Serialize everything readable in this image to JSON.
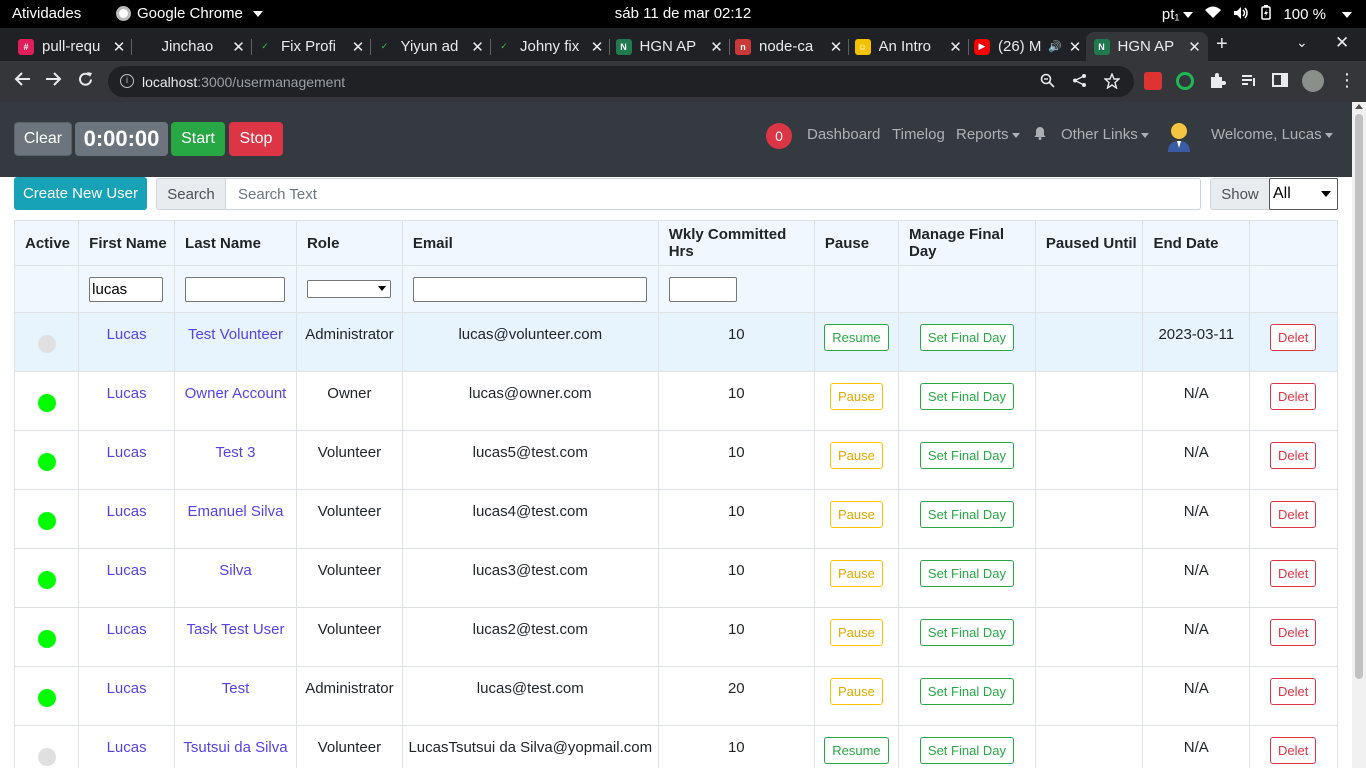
{
  "system": {
    "activities": "Atividades",
    "app_name": "Google Chrome",
    "clock": "sáb 11 de mar  02:12",
    "keyboard": "pt₁",
    "battery": "100 %"
  },
  "tabs": [
    {
      "title": "pull-requ",
      "favicon": "slack",
      "active": false
    },
    {
      "title": "Jinchao",
      "favicon": "github",
      "active": false
    },
    {
      "title": "Fix Profi",
      "favicon": "check",
      "active": false
    },
    {
      "title": "Yiyun ad",
      "favicon": "check",
      "active": false
    },
    {
      "title": "Johny fix",
      "favicon": "check",
      "active": false
    },
    {
      "title": "HGN AP",
      "favicon": "hgn",
      "active": false
    },
    {
      "title": "node-ca",
      "favicon": "npm",
      "active": false
    },
    {
      "title": "An Intro",
      "favicon": "smiley",
      "active": false
    },
    {
      "title": "(26) M",
      "favicon": "youtube",
      "active": false
    },
    {
      "title": "HGN AP",
      "favicon": "hgn",
      "active": true
    }
  ],
  "address_bar": {
    "host": "localhost",
    "path": ":3000/usermanagement"
  },
  "timer": {
    "clear": "Clear",
    "time": "0:00:00",
    "start": "Start",
    "stop": "Stop"
  },
  "nav": {
    "badge": "0",
    "dashboard": "Dashboard",
    "timelog": "Timelog",
    "reports": "Reports",
    "other_links": "Other Links",
    "welcome": "Welcome, Lucas"
  },
  "controls": {
    "create": "Create New User",
    "search_label": "Search",
    "search_placeholder": "Search Text",
    "show_label": "Show",
    "show_value": "All"
  },
  "columns": [
    "Active",
    "First Name",
    "Last Name",
    "Role",
    "Email",
    "Wkly Committed Hrs",
    "Pause",
    "Manage Final Day",
    "Paused Until",
    "End Date",
    ""
  ],
  "filters": {
    "first_name": "lucas",
    "last_name": "",
    "email": "",
    "hours": ""
  },
  "users": [
    {
      "active": false,
      "first": "Lucas",
      "last": "Test Volunteer",
      "role": "Administrator",
      "email": "lucas@volunteer.com",
      "hours": "10",
      "pause": "Resume",
      "final": "Set Final Day",
      "paused_until": "",
      "end": "2023-03-11",
      "del": "Delet",
      "highlight": true
    },
    {
      "active": true,
      "first": "Lucas",
      "last": "Owner Account",
      "role": "Owner",
      "email": "lucas@owner.com",
      "hours": "10",
      "pause": "Pause",
      "final": "Set Final Day",
      "paused_until": "",
      "end": "N/A",
      "del": "Delet",
      "highlight": false
    },
    {
      "active": true,
      "first": "Lucas",
      "last": "Test 3",
      "role": "Volunteer",
      "email": "lucas5@test.com",
      "hours": "10",
      "pause": "Pause",
      "final": "Set Final Day",
      "paused_until": "",
      "end": "N/A",
      "del": "Delet",
      "highlight": false
    },
    {
      "active": true,
      "first": "Lucas",
      "last": "Emanuel Silva",
      "role": "Volunteer",
      "email": "lucas4@test.com",
      "hours": "10",
      "pause": "Pause",
      "final": "Set Final Day",
      "paused_until": "",
      "end": "N/A",
      "del": "Delet",
      "highlight": false
    },
    {
      "active": true,
      "first": "Lucas",
      "last": "Silva",
      "role": "Volunteer",
      "email": "lucas3@test.com",
      "hours": "10",
      "pause": "Pause",
      "final": "Set Final Day",
      "paused_until": "",
      "end": "N/A",
      "del": "Delet",
      "highlight": false
    },
    {
      "active": true,
      "first": "Lucas",
      "last": "Task Test User",
      "role": "Volunteer",
      "email": "lucas2@test.com",
      "hours": "10",
      "pause": "Pause",
      "final": "Set Final Day",
      "paused_until": "",
      "end": "N/A",
      "del": "Delet",
      "highlight": false
    },
    {
      "active": true,
      "first": "Lucas",
      "last": "Test",
      "role": "Administrator",
      "email": "lucas@test.com",
      "hours": "20",
      "pause": "Pause",
      "final": "Set Final Day",
      "paused_until": "",
      "end": "N/A",
      "del": "Delet",
      "highlight": false
    },
    {
      "active": false,
      "first": "Lucas",
      "last": "Tsutsui da Silva",
      "role": "Volunteer",
      "email": "LucasTsutsui da Silva@yopmail.com",
      "hours": "10",
      "pause": "Resume",
      "final": "Set Final Day",
      "paused_until": "",
      "end": "N/A",
      "del": "Delet",
      "highlight": false
    }
  ],
  "colors": {
    "navbar": "#343a40",
    "create_button": "#17a2b8",
    "start": "#28a745",
    "stop": "#dc3545",
    "active_dot": "#00ff00",
    "inactive_dot": "#e0e0e0",
    "link": "#5742e6"
  }
}
